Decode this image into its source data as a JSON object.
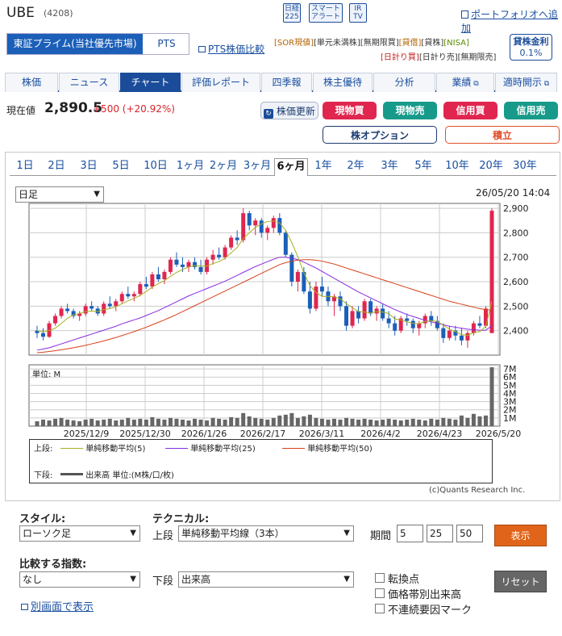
{
  "header": {
    "title": "UBE",
    "code": "(4208)",
    "icons": [
      {
        "name": "nikkei-225-icon",
        "l1": "日経",
        "l2": "225"
      },
      {
        "name": "smart-alert-icon",
        "l1": "スマート",
        "l2": "アラート"
      },
      {
        "name": "ir-tv-icon",
        "l1": "IR",
        "l2": "TV"
      }
    ],
    "portfolio_link": "ポートフォリオへ追加"
  },
  "market": {
    "primary": "東証プライム(当社優先市場)",
    "pts": "PTS",
    "pts_compare": "PTS株価比較"
  },
  "tags_row1": [
    "[SOR現値]",
    "[単元未満株]",
    "[無期限買]",
    "[貸借]",
    "[貸株]",
    "[NISA]"
  ],
  "tags_row2": [
    "[日計り買]",
    "[日計り売]",
    "[無期限売]"
  ],
  "loan": {
    "label": "貸株金利",
    "rate": "0.1%"
  },
  "tabs": [
    "株価",
    "ニュース",
    "チャート",
    "評価レポート",
    "四季報",
    "株主優待",
    "分析",
    "業績",
    "適時開示"
  ],
  "price": {
    "label": "現在値",
    "value": "2,890.5",
    "change": "+500 (+20.92%)",
    "update_button": "株価更新"
  },
  "trade_buttons": {
    "cash_buy": "現物買",
    "cash_sell": "現物売",
    "margin_buy": "信用買",
    "margin_sell": "信用売",
    "option": "株オプション",
    "accumulate": "積立"
  },
  "periods": [
    "1日",
    "2日",
    "3日",
    "5日",
    "10日",
    "1ヶ月",
    "2ヶ月",
    "3ヶ月",
    "6ヶ月",
    "1年",
    "2年",
    "3年",
    "5年",
    "10年",
    "20年",
    "30年"
  ],
  "active_period": "6ヶ月",
  "chart_controls": {
    "interval": "日足",
    "timestamp": "26/05/20 14:04"
  },
  "chart_data": {
    "type": "candlestick",
    "x_labels": [
      "2025/12/9",
      "2025/12/30",
      "2026/1/26",
      "2026/2/17",
      "2026/3/11",
      "2026/4/2",
      "2026/4/23",
      "2026/5/20"
    ],
    "price_ticks": [
      "2,900",
      "2,800",
      "2,700",
      "2,600",
      "2,500",
      "2,400"
    ],
    "ylim": [
      2300,
      2920
    ],
    "volume_ticks": [
      "7M",
      "6M",
      "5M",
      "4M",
      "3M",
      "2M",
      "1M"
    ],
    "volume_unit": "単位: M",
    "volume_max": 7.5,
    "legend_upper_label": "上段:",
    "legend_lower_label": "下段:",
    "legend": [
      {
        "name": "単純移動平均(5)",
        "color": "#a8b020"
      },
      {
        "name": "単純移動平均(25)",
        "color": "#8a2be2"
      },
      {
        "name": "単純移動平均(50)",
        "color": "#d8401a"
      }
    ],
    "volume_legend": "出来高 単位:(M株/口/枚)",
    "credit": "(c)Quants Research Inc.",
    "candles": [
      [
        2400,
        2420,
        2370,
        2390
      ],
      [
        2390,
        2410,
        2360,
        2375
      ],
      [
        2375,
        2440,
        2370,
        2430
      ],
      [
        2430,
        2470,
        2420,
        2460
      ],
      [
        2460,
        2500,
        2450,
        2490
      ],
      [
        2490,
        2510,
        2470,
        2480
      ],
      [
        2480,
        2490,
        2450,
        2460
      ],
      [
        2460,
        2480,
        2440,
        2470
      ],
      [
        2470,
        2510,
        2460,
        2500
      ],
      [
        2500,
        2520,
        2480,
        2490
      ],
      [
        2490,
        2500,
        2460,
        2470
      ],
      [
        2470,
        2520,
        2460,
        2510
      ],
      [
        2510,
        2540,
        2490,
        2500
      ],
      [
        2500,
        2530,
        2480,
        2520
      ],
      [
        2520,
        2560,
        2510,
        2550
      ],
      [
        2550,
        2580,
        2530,
        2540
      ],
      [
        2540,
        2560,
        2520,
        2550
      ],
      [
        2550,
        2600,
        2540,
        2590
      ],
      [
        2590,
        2620,
        2570,
        2580
      ],
      [
        2580,
        2640,
        2570,
        2630
      ],
      [
        2630,
        2660,
        2600,
        2610
      ],
      [
        2610,
        2650,
        2590,
        2640
      ],
      [
        2640,
        2700,
        2630,
        2690
      ],
      [
        2690,
        2720,
        2660,
        2670
      ],
      [
        2670,
        2700,
        2640,
        2660
      ],
      [
        2660,
        2690,
        2640,
        2680
      ],
      [
        2680,
        2700,
        2650,
        2660
      ],
      [
        2660,
        2690,
        2630,
        2640
      ],
      [
        2640,
        2700,
        2630,
        2690
      ],
      [
        2690,
        2730,
        2670,
        2710
      ],
      [
        2710,
        2740,
        2690,
        2700
      ],
      [
        2700,
        2750,
        2690,
        2740
      ],
      [
        2740,
        2790,
        2730,
        2780
      ],
      [
        2780,
        2810,
        2750,
        2770
      ],
      [
        2770,
        2900,
        2760,
        2880
      ],
      [
        2880,
        2890,
        2810,
        2830
      ],
      [
        2830,
        2860,
        2790,
        2850
      ],
      [
        2850,
        2860,
        2780,
        2800
      ],
      [
        2800,
        2830,
        2770,
        2820
      ],
      [
        2820,
        2870,
        2800,
        2860
      ],
      [
        2860,
        2880,
        2790,
        2800
      ],
      [
        2800,
        2810,
        2700,
        2710
      ],
      [
        2710,
        2720,
        2580,
        2600
      ],
      [
        2600,
        2650,
        2560,
        2640
      ],
      [
        2640,
        2660,
        2550,
        2560
      ],
      [
        2560,
        2600,
        2470,
        2490
      ],
      [
        2490,
        2600,
        2480,
        2580
      ],
      [
        2580,
        2620,
        2540,
        2560
      ],
      [
        2560,
        2580,
        2500,
        2520
      ],
      [
        2520,
        2550,
        2460,
        2540
      ],
      [
        2540,
        2560,
        2480,
        2500
      ],
      [
        2500,
        2520,
        2400,
        2420
      ],
      [
        2420,
        2500,
        2410,
        2480
      ],
      [
        2480,
        2500,
        2430,
        2450
      ],
      [
        2450,
        2530,
        2440,
        2520
      ],
      [
        2520,
        2530,
        2460,
        2470
      ],
      [
        2470,
        2500,
        2440,
        2490
      ],
      [
        2490,
        2510,
        2440,
        2450
      ],
      [
        2450,
        2480,
        2410,
        2430
      ],
      [
        2430,
        2460,
        2380,
        2400
      ],
      [
        2400,
        2460,
        2390,
        2450
      ],
      [
        2450,
        2470,
        2420,
        2440
      ],
      [
        2440,
        2450,
        2390,
        2410
      ],
      [
        2410,
        2440,
        2380,
        2430
      ],
      [
        2430,
        2470,
        2410,
        2460
      ],
      [
        2460,
        2480,
        2420,
        2440
      ],
      [
        2440,
        2460,
        2400,
        2410
      ],
      [
        2410,
        2430,
        2350,
        2370
      ],
      [
        2370,
        2420,
        2360,
        2400
      ],
      [
        2400,
        2420,
        2360,
        2380
      ],
      [
        2380,
        2410,
        2340,
        2360
      ],
      [
        2360,
        2400,
        2330,
        2390
      ],
      [
        2390,
        2440,
        2380,
        2430
      ],
      [
        2430,
        2460,
        2410,
        2420
      ],
      [
        2420,
        2500,
        2410,
        2490
      ],
      [
        2390,
        2900,
        2390,
        2890
      ]
    ],
    "ma5": [
      2400,
      2395,
      2400,
      2410,
      2430,
      2450,
      2465,
      2470,
      2478,
      2480,
      2478,
      2486,
      2490,
      2498,
      2510,
      2522,
      2532,
      2544,
      2560,
      2578,
      2592,
      2604,
      2622,
      2638,
      2650,
      2660,
      2666,
      2664,
      2664,
      2674,
      2682,
      2696,
      2718,
      2740,
      2776,
      2800,
      2822,
      2836,
      2846,
      2848,
      2840,
      2810,
      2760,
      2702,
      2636,
      2584,
      2556,
      2540,
      2540,
      2538,
      2530,
      2510,
      2494,
      2478,
      2476,
      2472,
      2478,
      2476,
      2470,
      2448,
      2444,
      2436,
      2430,
      2428,
      2438,
      2440,
      2438,
      2422,
      2406,
      2396,
      2384,
      2380,
      2392,
      2396,
      2418,
      2520
    ],
    "ma25": [
      2320,
      2325,
      2330,
      2338,
      2346,
      2354,
      2362,
      2370,
      2378,
      2386,
      2394,
      2402,
      2410,
      2418,
      2428,
      2436,
      2444,
      2452,
      2462,
      2472,
      2482,
      2494,
      2506,
      2518,
      2530,
      2542,
      2552,
      2562,
      2572,
      2582,
      2592,
      2602,
      2614,
      2626,
      2638,
      2650,
      2662,
      2672,
      2682,
      2692,
      2700,
      2700,
      2696,
      2690,
      2680,
      2668,
      2656,
      2642,
      2628,
      2614,
      2600,
      2586,
      2572,
      2558,
      2546,
      2534,
      2522,
      2510,
      2498,
      2486,
      2476,
      2466,
      2458,
      2450,
      2442,
      2436,
      2430,
      2424,
      2418,
      2414,
      2410,
      2406,
      2404,
      2402,
      2402,
      2420
    ],
    "ma50": [
      2310,
      2312,
      2315,
      2318,
      2322,
      2326,
      2330,
      2335,
      2340,
      2346,
      2352,
      2358,
      2365,
      2372,
      2380,
      2388,
      2396,
      2405,
      2414,
      2424,
      2434,
      2444,
      2455,
      2466,
      2478,
      2490,
      2502,
      2514,
      2526,
      2538,
      2550,
      2562,
      2574,
      2586,
      2598,
      2610,
      2622,
      2634,
      2646,
      2658,
      2670,
      2678,
      2684,
      2688,
      2690,
      2690,
      2688,
      2684,
      2678,
      2672,
      2664,
      2656,
      2648,
      2640,
      2632,
      2624,
      2616,
      2608,
      2600,
      2592,
      2584,
      2576,
      2568,
      2560,
      2552,
      2544,
      2536,
      2528,
      2520,
      2514,
      2508,
      2502,
      2496,
      2490,
      2486,
      2484
    ],
    "volume": [
      0.6,
      0.8,
      0.7,
      0.9,
      1.0,
      0.8,
      0.7,
      0.6,
      0.8,
      0.9,
      0.7,
      0.8,
      0.9,
      0.7,
      0.8,
      1.0,
      0.8,
      0.9,
      0.8,
      1.1,
      0.9,
      0.8,
      1.0,
      0.9,
      0.8,
      0.7,
      0.9,
      0.8,
      0.7,
      1.0,
      0.9,
      0.8,
      1.1,
      1.0,
      1.6,
      1.2,
      1.0,
      0.9,
      0.8,
      1.0,
      1.3,
      1.4,
      1.6,
      1.0,
      1.2,
      1.4,
      1.0,
      0.9,
      0.8,
      0.9,
      0.8,
      1.0,
      0.9,
      0.8,
      0.9,
      0.8,
      0.7,
      0.8,
      0.9,
      0.8,
      0.7,
      0.8,
      0.9,
      0.8,
      0.7,
      0.9,
      0.8,
      1.0,
      0.9,
      0.8,
      1.3,
      1.0,
      1.5,
      1.2,
      1.3,
      7.2
    ]
  },
  "controls": {
    "style_label": "スタイル:",
    "style_value": "ローソク足",
    "technical_label": "テクニカル:",
    "upper_label": "上段",
    "upper_value": "単純移動平均線（3本）",
    "period_label": "期間",
    "periods": [
      "5",
      "25",
      "50"
    ],
    "show_button": "表示",
    "compare_label": "比較する指数:",
    "compare_value": "なし",
    "lower_label": "下段",
    "lower_value": "出来高",
    "checkboxes": [
      "転換点",
      "価格帯別出来高",
      "不連続要因マーク"
    ],
    "reset_button": "リセット",
    "separate_link": "別画面で表示"
  }
}
